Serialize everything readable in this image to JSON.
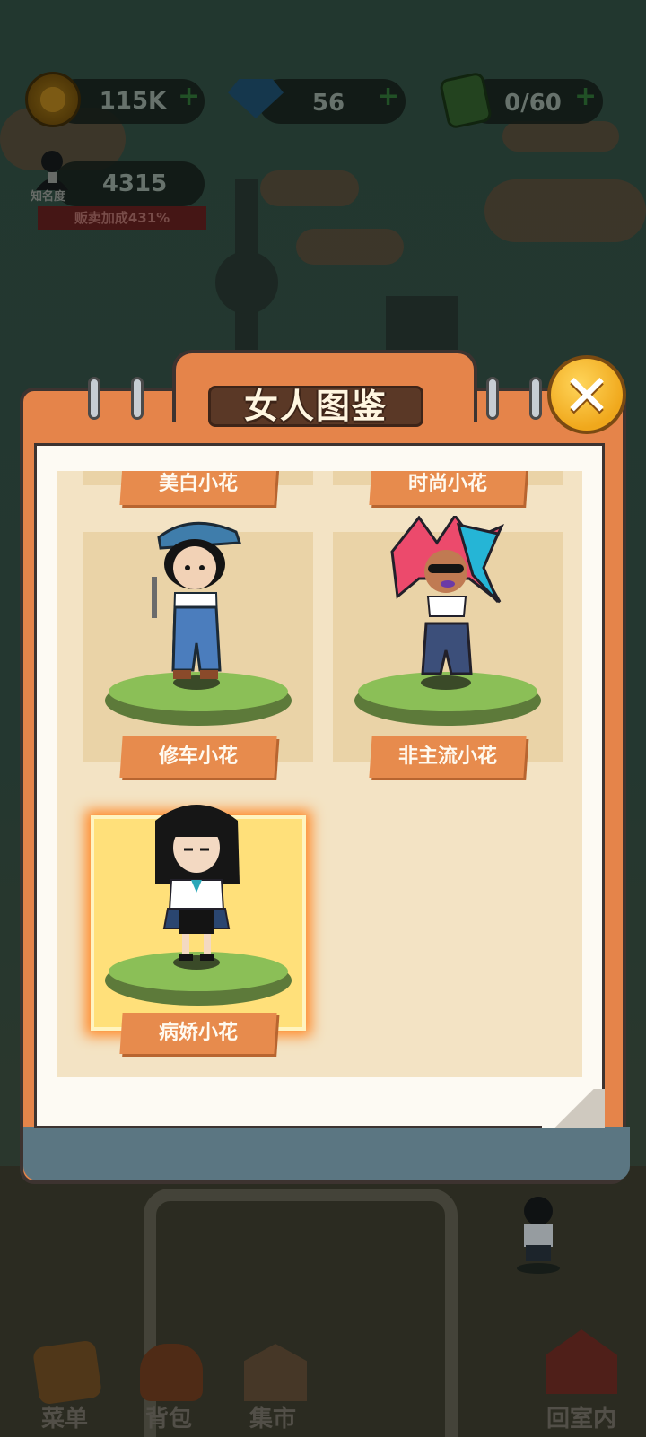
{
  "hud": {
    "coins": "115K",
    "gems": "56",
    "energy": "0/60",
    "fame_label": "知名度",
    "fame_value": "4315",
    "sales_bonus": "贩卖加成431%"
  },
  "modal": {
    "title": "女人图鉴",
    "close_symbol": "✕",
    "cards": [
      {
        "label": "美白小花",
        "partial": true
      },
      {
        "label": "时尚小花",
        "partial": true
      },
      {
        "label": "修车小花",
        "selected": false
      },
      {
        "label": "非主流小花",
        "selected": false
      },
      {
        "label": "病娇小花",
        "selected": true
      }
    ]
  },
  "bottom_nav": [
    {
      "label": "菜单",
      "icon": "menu-book-icon"
    },
    {
      "label": "背包",
      "icon": "backpack-icon"
    },
    {
      "label": "集市",
      "icon": "market-icon"
    },
    {
      "label": "回室内",
      "icon": "home-return-icon"
    }
  ],
  "colors": {
    "panel_orange": "#e5844a",
    "label_orange": "#e78b4d",
    "card_bg": "#ead3a7",
    "selected_card": "#ffe07a",
    "close_gold": "#f0a81c"
  }
}
